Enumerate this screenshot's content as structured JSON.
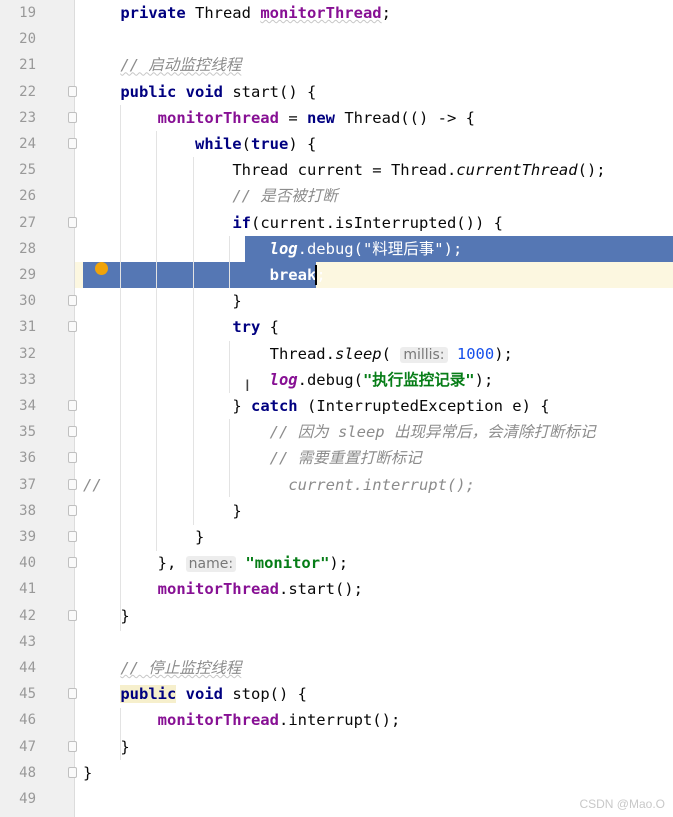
{
  "lines": [
    {
      "n": "19",
      "tokens": [
        [
          "    ",
          ""
        ],
        [
          "private ",
          "kw-plain"
        ],
        [
          "Thread ",
          ""
        ],
        [
          "monitorThread",
          "field wavy"
        ],
        [
          ";",
          ""
        ]
      ]
    },
    {
      "n": "20",
      "tokens": []
    },
    {
      "n": "21",
      "tokens": [
        [
          "    ",
          ""
        ],
        [
          "// 启动监控线程",
          "cmt wavy"
        ]
      ]
    },
    {
      "n": "22",
      "tokens": [
        [
          "    ",
          ""
        ],
        [
          "public ",
          "kw-plain"
        ],
        [
          "void ",
          "kw-plain"
        ],
        [
          "start() {",
          ""
        ]
      ]
    },
    {
      "n": "23",
      "tokens": [
        [
          "        ",
          ""
        ],
        [
          "monitorThread",
          "field"
        ],
        [
          " = ",
          ""
        ],
        [
          "new ",
          "kw-plain"
        ],
        [
          "Thread(() -> {",
          ""
        ]
      ]
    },
    {
      "n": "24",
      "tokens": [
        [
          "            ",
          ""
        ],
        [
          "while",
          "kw-plain"
        ],
        [
          "(",
          ""
        ],
        [
          "true",
          "kw-plain"
        ],
        [
          ") {",
          ""
        ]
      ]
    },
    {
      "n": "25",
      "tokens": [
        [
          "                ",
          ""
        ],
        [
          "Thread current = Thread.",
          ""
        ],
        [
          "currentThread",
          "ital"
        ],
        [
          "();",
          ""
        ]
      ]
    },
    {
      "n": "26",
      "tokens": [
        [
          "                ",
          ""
        ],
        [
          "// 是否被打断",
          "cmt"
        ]
      ]
    },
    {
      "n": "27",
      "tokens": [
        [
          "                ",
          ""
        ],
        [
          "if",
          "kw-plain"
        ],
        [
          "(current.isInterrupted()) {",
          ""
        ]
      ]
    },
    {
      "n": "28",
      "tokens": [
        [
          "                    ",
          ""
        ],
        [
          "log",
          "ital sel-text kw"
        ],
        [
          ".debug(",
          ""
        ],
        [
          "\"料理后事\"",
          "sel-text"
        ],
        [
          ");",
          ""
        ]
      ]
    },
    {
      "n": "29",
      "tokens": [
        [
          "                    ",
          ""
        ],
        [
          "break",
          "sel-text kw"
        ],
        [
          ";",
          "sel-text"
        ]
      ]
    },
    {
      "n": "30",
      "tokens": [
        [
          "                ",
          ""
        ],
        [
          "}",
          ""
        ]
      ]
    },
    {
      "n": "31",
      "tokens": [
        [
          "                ",
          ""
        ],
        [
          "try ",
          "kw-plain"
        ],
        [
          "{",
          ""
        ]
      ]
    },
    {
      "n": "32",
      "tokens": [
        [
          "                    ",
          ""
        ],
        [
          "Thread.",
          ""
        ],
        [
          "sleep",
          "ital"
        ],
        [
          "( ",
          ""
        ],
        [
          "millis:",
          "hint"
        ],
        [
          " ",
          ""
        ],
        [
          "1000",
          "num"
        ],
        [
          ");",
          ""
        ]
      ]
    },
    {
      "n": "33",
      "tokens": [
        [
          "                    ",
          ""
        ],
        [
          "log",
          "ital field"
        ],
        [
          ".debug(",
          ""
        ],
        [
          "\"执行监控记录\"",
          "str"
        ],
        [
          ");",
          ""
        ]
      ]
    },
    {
      "n": "34",
      "tokens": [
        [
          "                ",
          ""
        ],
        [
          "} ",
          ""
        ],
        [
          "catch ",
          "kw-plain"
        ],
        [
          "(InterruptedException e) {",
          ""
        ]
      ]
    },
    {
      "n": "35",
      "tokens": [
        [
          "                    ",
          ""
        ],
        [
          "// 因为 sleep 出现异常后，会清除打断标记",
          "cmt"
        ]
      ]
    },
    {
      "n": "36",
      "tokens": [
        [
          "                    ",
          ""
        ],
        [
          "// 需要重置打断标记",
          "cmt"
        ]
      ]
    },
    {
      "n": "37",
      "tokens": [
        [
          "//",
          "cmt"
        ],
        [
          "                    ",
          ""
        ],
        [
          "current.interrupt();",
          "cmt"
        ]
      ]
    },
    {
      "n": "38",
      "tokens": [
        [
          "                ",
          ""
        ],
        [
          "}",
          ""
        ]
      ]
    },
    {
      "n": "39",
      "tokens": [
        [
          "            ",
          ""
        ],
        [
          "}",
          ""
        ]
      ]
    },
    {
      "n": "40",
      "tokens": [
        [
          "        ",
          ""
        ],
        [
          "}, ",
          ""
        ],
        [
          "name:",
          "hint"
        ],
        [
          " ",
          ""
        ],
        [
          "\"monitor\"",
          "str"
        ],
        [
          ");",
          ""
        ]
      ]
    },
    {
      "n": "41",
      "tokens": [
        [
          "        ",
          ""
        ],
        [
          "monitorThread",
          "field"
        ],
        [
          ".start();",
          ""
        ]
      ]
    },
    {
      "n": "42",
      "tokens": [
        [
          "    ",
          ""
        ],
        [
          "}",
          ""
        ]
      ]
    },
    {
      "n": "43",
      "tokens": []
    },
    {
      "n": "44",
      "tokens": [
        [
          "    ",
          ""
        ],
        [
          "// 停止监控线程",
          "cmt wavy"
        ]
      ]
    },
    {
      "n": "45",
      "tokens": [
        [
          "    ",
          ""
        ],
        [
          "public",
          "kw-plain hl-public"
        ],
        [
          " ",
          ""
        ],
        [
          "void ",
          "kw-plain"
        ],
        [
          "stop() {",
          ""
        ]
      ]
    },
    {
      "n": "46",
      "tokens": [
        [
          "        ",
          ""
        ],
        [
          "monitorThread",
          "field"
        ],
        [
          ".interrupt();",
          ""
        ]
      ]
    },
    {
      "n": "47",
      "tokens": [
        [
          "    ",
          ""
        ],
        [
          "}",
          ""
        ]
      ]
    },
    {
      "n": "48",
      "tokens": [
        [
          "}",
          ""
        ]
      ]
    },
    {
      "n": "49",
      "tokens": []
    }
  ],
  "watermark": "CSDN @Mao.O"
}
